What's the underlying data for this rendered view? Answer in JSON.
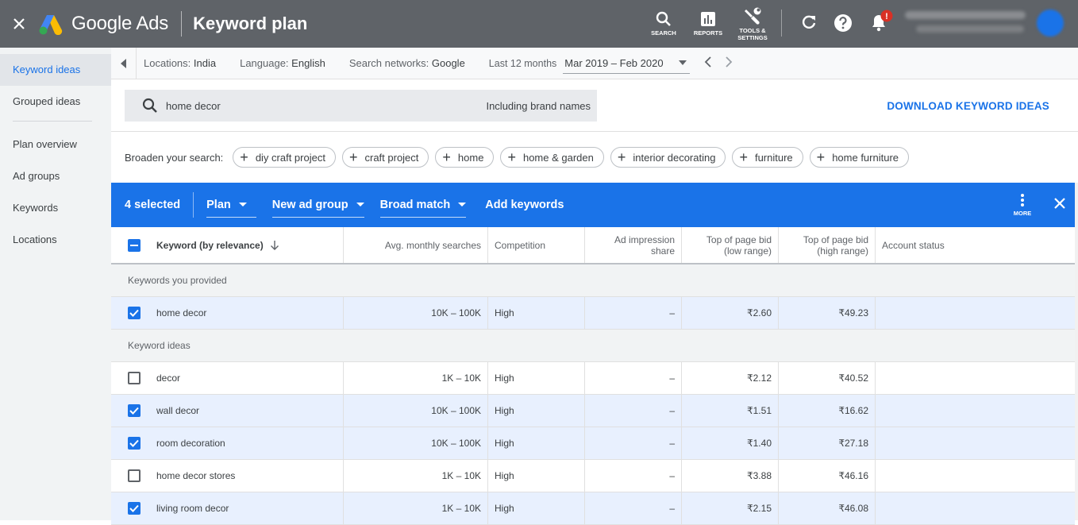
{
  "header": {
    "brand": "Google Ads",
    "page_title": "Keyword plan",
    "tools": [
      {
        "label": "SEARCH",
        "icon": "search-icon"
      },
      {
        "label": "REPORTS",
        "icon": "reports-icon"
      },
      {
        "label": "TOOLS &\nSETTINGS",
        "icon": "wrench-icon"
      }
    ],
    "notification_badge": "!"
  },
  "sidebar": {
    "items": [
      {
        "label": "Keyword ideas",
        "active": true
      },
      {
        "label": "Grouped ideas"
      },
      {
        "label": "Plan overview"
      },
      {
        "label": "Ad groups"
      },
      {
        "label": "Keywords"
      },
      {
        "label": "Locations"
      }
    ]
  },
  "filters": {
    "locations_label": "Locations:",
    "locations_value": "India",
    "language_label": "Language:",
    "language_value": "English",
    "networks_label": "Search networks:",
    "networks_value": "Google",
    "period_label": "Last 12 months",
    "period_value": "Mar 2019 – Feb 2020"
  },
  "search": {
    "query": "home decor",
    "option": "Including brand names",
    "download_label": "DOWNLOAD KEYWORD IDEAS"
  },
  "broaden": {
    "label": "Broaden your search:",
    "chips": [
      "diy craft project",
      "craft project",
      "home",
      "home & garden",
      "interior decorating",
      "furniture",
      "home furniture"
    ]
  },
  "selection_bar": {
    "count_label": "4 selected",
    "plan_label": "Plan",
    "ad_group_label": "New ad group",
    "match_label": "Broad match",
    "add_keywords_label": "Add keywords",
    "more_label": "MORE"
  },
  "table": {
    "headers": {
      "keyword": "Keyword (by relevance)",
      "searches": "Avg. monthly searches",
      "competition": "Competition",
      "impression_1": "Ad impression",
      "impression_2": "share",
      "bid_low_1": "Top of page bid",
      "bid_low_2": "(low range)",
      "bid_high_1": "Top of page bid",
      "bid_high_2": "(high range)",
      "status": "Account status"
    },
    "provided_section": "Keywords you provided",
    "ideas_section": "Keyword ideas",
    "provided": [
      {
        "keyword": "home decor",
        "searches": "10K – 100K",
        "competition": "High",
        "impression": "–",
        "bid_low": "₹2.60",
        "bid_high": "₹49.23",
        "checked": true
      }
    ],
    "ideas": [
      {
        "keyword": "decor",
        "searches": "1K – 10K",
        "competition": "High",
        "impression": "–",
        "bid_low": "₹2.12",
        "bid_high": "₹40.52",
        "checked": false
      },
      {
        "keyword": "wall decor",
        "searches": "10K – 100K",
        "competition": "High",
        "impression": "–",
        "bid_low": "₹1.51",
        "bid_high": "₹16.62",
        "checked": true
      },
      {
        "keyword": "room decoration",
        "searches": "10K – 100K",
        "competition": "High",
        "impression": "–",
        "bid_low": "₹1.40",
        "bid_high": "₹27.18",
        "checked": true
      },
      {
        "keyword": "home decor stores",
        "searches": "1K – 10K",
        "competition": "High",
        "impression": "–",
        "bid_low": "₹3.88",
        "bid_high": "₹46.16",
        "checked": false
      },
      {
        "keyword": "living room decor",
        "searches": "1K – 10K",
        "competition": "High",
        "impression": "–",
        "bid_low": "₹2.15",
        "bid_high": "₹46.08",
        "checked": true
      }
    ]
  },
  "colors": {
    "topbar": "#5f6368",
    "accent": "#1a73e8",
    "selected_row": "#e8f0fe",
    "sidebar": "#f1f3f4"
  }
}
